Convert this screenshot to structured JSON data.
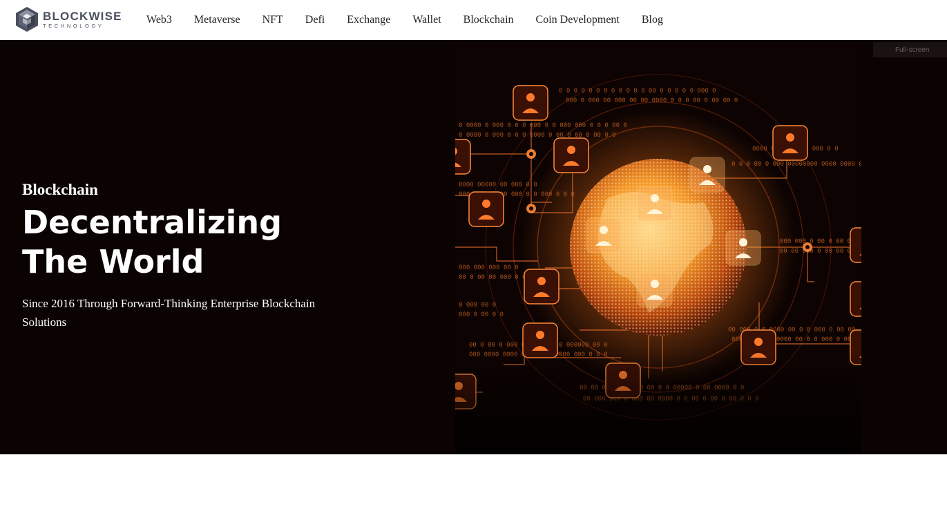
{
  "brand": {
    "name": "BLOCKWISE",
    "tagline": "TECHNOLOGY"
  },
  "nav": {
    "items": [
      "Web3",
      "Metaverse",
      "NFT",
      "Defi",
      "Exchange",
      "Wallet",
      "Blockchain",
      "Coin Development",
      "Blog"
    ]
  },
  "hero": {
    "eyebrow": "Blockchain",
    "headline": "Decentralizing The World",
    "subhead": "Since 2016 Through Forward-Thinking Enterprise Blockchain Solutions",
    "fullscreen_label": "Full-screen",
    "colors": {
      "background": "#0b0302",
      "accent": "#f07a1e",
      "glow": "#ff9a3c"
    }
  }
}
